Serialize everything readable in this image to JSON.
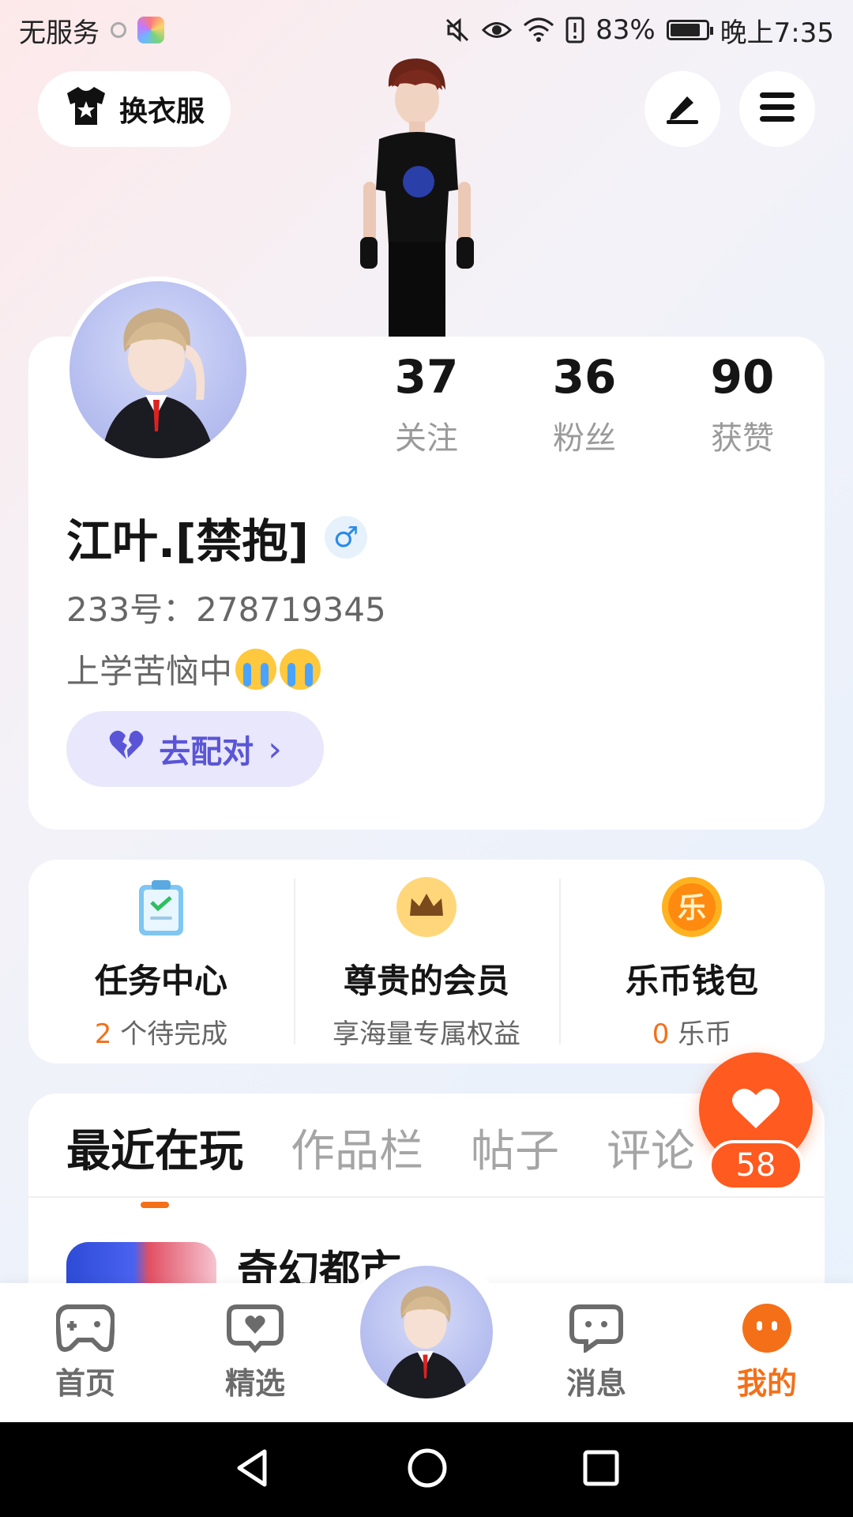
{
  "status": {
    "carrier": "无服务",
    "battery_text": "83%",
    "battery_level": 0.83,
    "time": "晚上7:35"
  },
  "header": {
    "outfit_label": "换衣服",
    "icons": [
      "tshirt-icon",
      "pen-icon",
      "menu-icon"
    ]
  },
  "profile": {
    "stats": [
      {
        "value": "37",
        "label": "关注"
      },
      {
        "value": "36",
        "label": "粉丝"
      },
      {
        "value": "90",
        "label": "获赞"
      }
    ],
    "username": "江叶.[禁抱]",
    "gender_symbol": "♂",
    "user_id": "233号：278719345",
    "bio": "上学苦恼中",
    "match_label": "去配对",
    "match_chevron": "›"
  },
  "services": [
    {
      "icon": "clipboard-check-icon",
      "title": "任务中心",
      "count": "2",
      "sub": " 个待完成"
    },
    {
      "icon": "crown-icon",
      "title": "尊贵的会员",
      "count": "",
      "sub": "享海量专属权益"
    },
    {
      "icon": "le-coin-icon",
      "title": "乐币钱包",
      "count": "0",
      "sub": " 乐币",
      "coin_glyph": "乐"
    }
  ],
  "tabs": [
    "最近在玩",
    "作品栏",
    "帖子",
    "评论"
  ],
  "recent_game": {
    "title": "奇幻都市"
  },
  "float_like": {
    "count": "58"
  },
  "bottom_nav": [
    {
      "label": "首页",
      "icon": "gamepad-icon"
    },
    {
      "label": "精选",
      "icon": "heart-chat-icon"
    },
    {
      "label": "消息",
      "icon": "chat-bubble-icon"
    },
    {
      "label": "我的",
      "icon": "face-icon",
      "active": true
    }
  ],
  "colors": {
    "accent": "#f37019",
    "like": "#ff5a1f",
    "match_text": "#5a55d6",
    "match_bg": "#e8e7fb"
  }
}
